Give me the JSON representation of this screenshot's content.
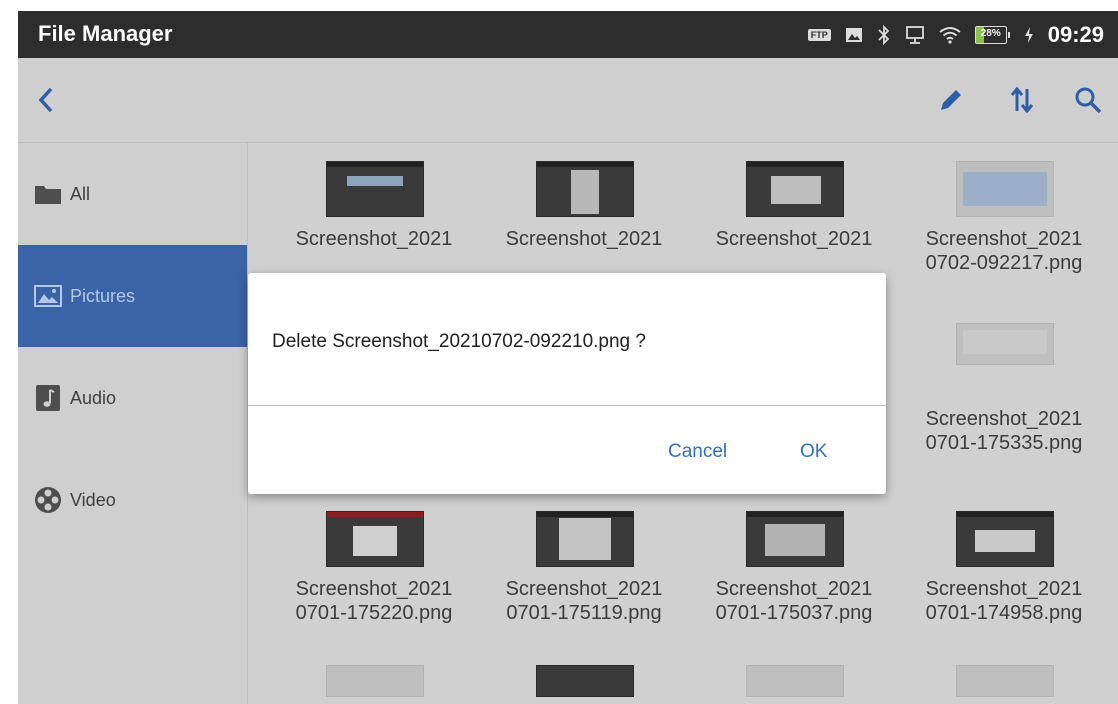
{
  "app_title": "File Manager",
  "status": {
    "icons": [
      "ftp-icon",
      "image-icon",
      "bluetooth-icon",
      "ethernet-icon",
      "wifi-icon",
      "battery-icon",
      "charging-icon"
    ],
    "ftp_label": "FTP",
    "battery_percent": 28,
    "battery_label": "28%",
    "time": "09:29"
  },
  "toolbar": {
    "icons": [
      "back-icon",
      "edit-icon",
      "sort-icon",
      "search-icon"
    ]
  },
  "sidebar": {
    "items": [
      {
        "label": "All",
        "icon": "folder-icon",
        "active": false
      },
      {
        "label": "Pictures",
        "icon": "picture-icon",
        "active": true
      },
      {
        "label": "Audio",
        "icon": "audio-icon",
        "active": false
      },
      {
        "label": "Video",
        "icon": "video-icon",
        "active": false
      }
    ]
  },
  "files": [
    {
      "line1": "Screenshot_2021",
      "line2": ""
    },
    {
      "line1": "Screenshot_2021",
      "line2": ""
    },
    {
      "line1": "Screenshot_2021",
      "line2": ""
    },
    {
      "line1": "Screenshot_2021",
      "line2": "0702-092217.png"
    },
    {
      "line1": "Screenshot_2021",
      "line2": "0701-175335.png"
    },
    {
      "line1": "Screenshot_2021",
      "line2": "0701-175220.png"
    },
    {
      "line1": "Screenshot_2021",
      "line2": "0701-175119.png"
    },
    {
      "line1": "Screenshot_2021",
      "line2": "0701-175037.png"
    },
    {
      "line1": "Screenshot_2021",
      "line2": "0701-174958.png"
    }
  ],
  "dialog": {
    "message": "Delete Screenshot_20210702-092210.png ?",
    "cancel_label": "Cancel",
    "ok_label": "OK"
  },
  "colors": {
    "accent": "#2f6fc8",
    "sidebar_active": "#3a63a8",
    "statusbar": "#2d2d2d"
  }
}
